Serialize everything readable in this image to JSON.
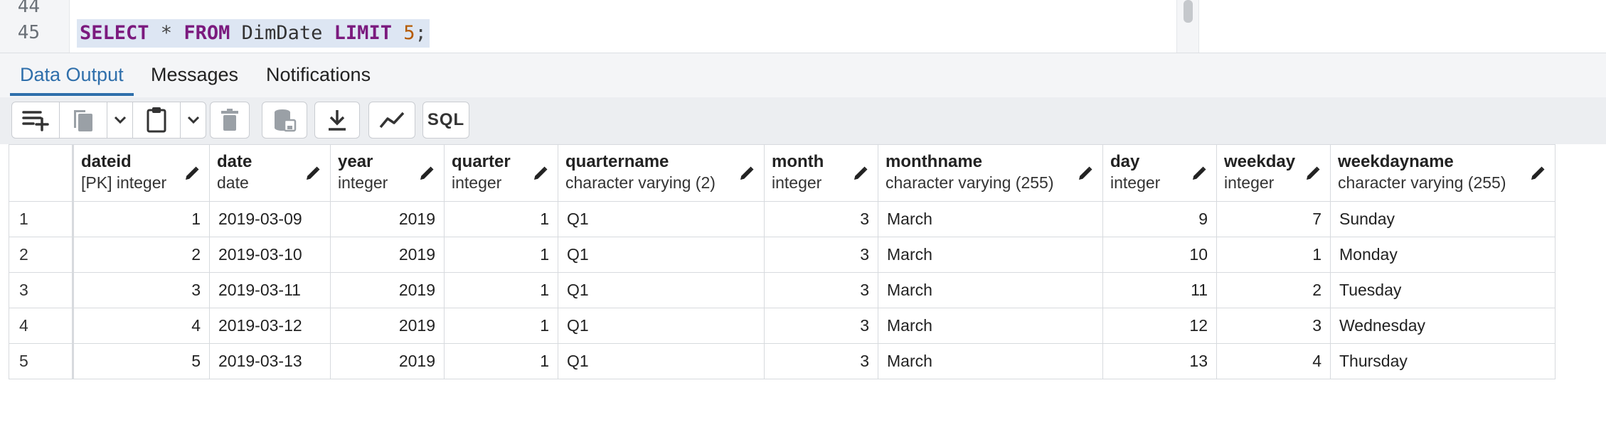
{
  "editor": {
    "line_numbers": [
      "44",
      "45"
    ],
    "query_tokens": [
      {
        "t": "SELECT",
        "c": "kw"
      },
      {
        "t": " * ",
        "c": "op"
      },
      {
        "t": "FROM",
        "c": "kw"
      },
      {
        "t": " DimDate ",
        "c": "id"
      },
      {
        "t": "LIMIT",
        "c": "kw"
      },
      {
        "t": " ",
        "c": "op"
      },
      {
        "t": "5",
        "c": "num"
      },
      {
        "t": ";",
        "c": "op"
      }
    ]
  },
  "tabs": [
    {
      "label": "Data Output",
      "active": true
    },
    {
      "label": "Messages",
      "active": false
    },
    {
      "label": "Notifications",
      "active": false
    }
  ],
  "toolbar": {
    "buttons": [
      {
        "name": "add-row-icon"
      },
      {
        "name": "copy-icon"
      },
      {
        "name": "copy-options-chevron-icon"
      },
      {
        "name": "paste-icon"
      },
      {
        "name": "paste-options-chevron-icon"
      },
      {
        "name": "delete-icon"
      },
      {
        "name": "save-data-icon"
      },
      {
        "name": "download-icon"
      },
      {
        "name": "graph-visualiser-icon"
      },
      {
        "name": "sql-icon",
        "label": "SQL"
      }
    ]
  },
  "grid": {
    "columns": [
      {
        "name": "dateid",
        "type": "[PK] integer",
        "align": "r"
      },
      {
        "name": "date",
        "type": "date",
        "align": "l"
      },
      {
        "name": "year",
        "type": "integer",
        "align": "r"
      },
      {
        "name": "quarter",
        "type": "integer",
        "align": "r"
      },
      {
        "name": "quartername",
        "type": "character varying (2)",
        "align": "l"
      },
      {
        "name": "month",
        "type": "integer",
        "align": "r"
      },
      {
        "name": "monthname",
        "type": "character varying (255)",
        "align": "l"
      },
      {
        "name": "day",
        "type": "integer",
        "align": "r"
      },
      {
        "name": "weekday",
        "type": "integer",
        "align": "r"
      },
      {
        "name": "weekdayname",
        "type": "character varying (255)",
        "align": "l"
      }
    ],
    "rows": [
      {
        "num": "1",
        "cells": [
          "1",
          "2019-03-09",
          "2019",
          "1",
          "Q1",
          "3",
          "March",
          "9",
          "7",
          "Sunday"
        ]
      },
      {
        "num": "2",
        "cells": [
          "2",
          "2019-03-10",
          "2019",
          "1",
          "Q1",
          "3",
          "March",
          "10",
          "1",
          "Monday"
        ]
      },
      {
        "num": "3",
        "cells": [
          "3",
          "2019-03-11",
          "2019",
          "1",
          "Q1",
          "3",
          "March",
          "11",
          "2",
          "Tuesday"
        ]
      },
      {
        "num": "4",
        "cells": [
          "4",
          "2019-03-12",
          "2019",
          "1",
          "Q1",
          "3",
          "March",
          "12",
          "3",
          "Wednesday"
        ]
      },
      {
        "num": "5",
        "cells": [
          "5",
          "2019-03-13",
          "2019",
          "1",
          "Q1",
          "3",
          "March",
          "13",
          "4",
          "Thursday"
        ]
      }
    ]
  }
}
